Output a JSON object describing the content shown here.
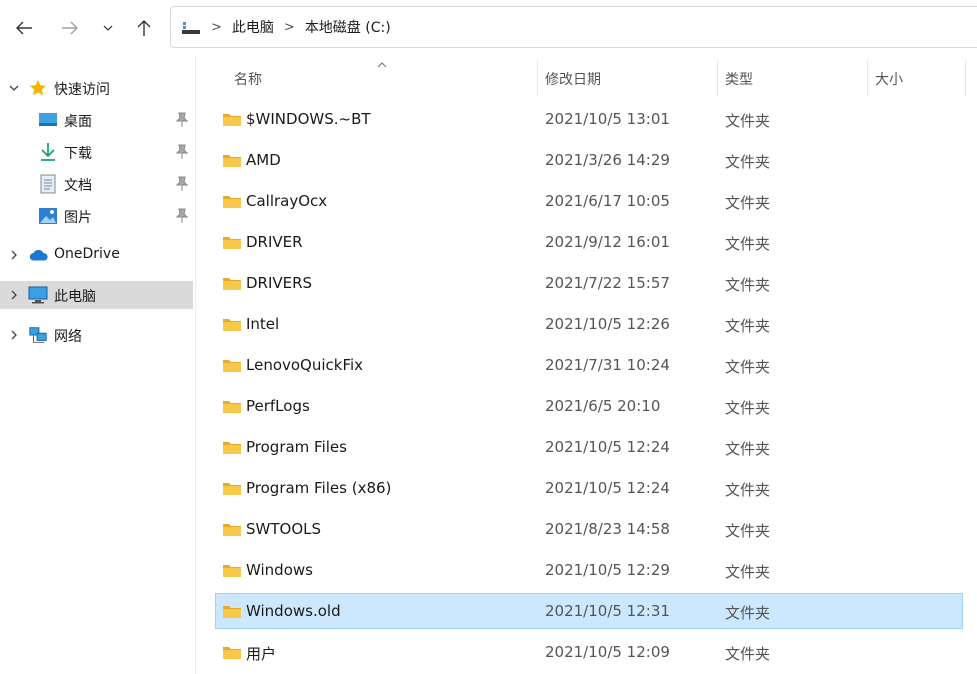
{
  "breadcrumb": [
    "此电脑",
    "本地磁盘 (C:)"
  ],
  "nav": {
    "quick_access": "快速访问",
    "pinned": [
      "桌面",
      "下载",
      "文档",
      "图片"
    ],
    "onedrive": "OneDrive",
    "this_pc": "此电脑",
    "network": "网络"
  },
  "columns": {
    "name": "名称",
    "modified": "修改日期",
    "type": "类型",
    "size": "大小"
  },
  "files": [
    {
      "name": "$WINDOWS.~BT",
      "modified": "2021/10/5 13:01",
      "type": "文件夹",
      "size": ""
    },
    {
      "name": "AMD",
      "modified": "2021/3/26 14:29",
      "type": "文件夹",
      "size": ""
    },
    {
      "name": "CallrayOcx",
      "modified": "2021/6/17 10:05",
      "type": "文件夹",
      "size": ""
    },
    {
      "name": "DRIVER",
      "modified": "2021/9/12 16:01",
      "type": "文件夹",
      "size": ""
    },
    {
      "name": "DRIVERS",
      "modified": "2021/7/22 15:57",
      "type": "文件夹",
      "size": ""
    },
    {
      "name": "Intel",
      "modified": "2021/10/5 12:26",
      "type": "文件夹",
      "size": ""
    },
    {
      "name": "LenovoQuickFix",
      "modified": "2021/7/31 10:24",
      "type": "文件夹",
      "size": ""
    },
    {
      "name": "PerfLogs",
      "modified": "2021/6/5 20:10",
      "type": "文件夹",
      "size": ""
    },
    {
      "name": "Program Files",
      "modified": "2021/10/5 12:24",
      "type": "文件夹",
      "size": ""
    },
    {
      "name": "Program Files (x86)",
      "modified": "2021/10/5 12:24",
      "type": "文件夹",
      "size": ""
    },
    {
      "name": "SWTOOLS",
      "modified": "2021/8/23 14:58",
      "type": "文件夹",
      "size": ""
    },
    {
      "name": "Windows",
      "modified": "2021/10/5 12:29",
      "type": "文件夹",
      "size": ""
    },
    {
      "name": "Windows.old",
      "modified": "2021/10/5 12:31",
      "type": "文件夹",
      "size": "",
      "selected": true
    },
    {
      "name": "用户",
      "modified": "2021/10/5 12:09",
      "type": "文件夹",
      "size": ""
    }
  ],
  "colors": {
    "selected_row": "#cce8ff",
    "selected_nav": "#dadada",
    "folder": "#f8c84a"
  },
  "icons": {
    "back": "arrow-left-icon",
    "forward": "arrow-right-icon",
    "recent": "chevron-down-icon",
    "up": "arrow-up-icon",
    "folder": "folder-icon",
    "pin": "pin-icon",
    "star": "star-icon"
  }
}
